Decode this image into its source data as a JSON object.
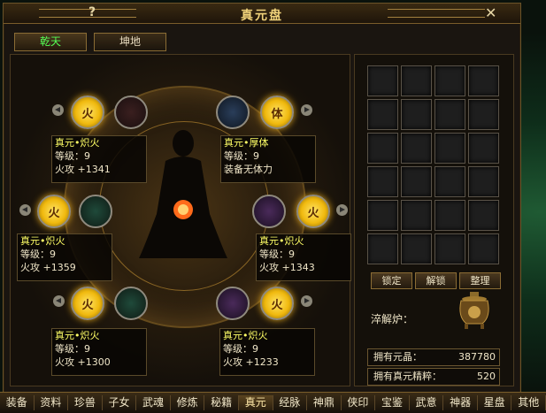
{
  "window": {
    "title": "真元盘",
    "help_label": "?",
    "close_label": "✕"
  },
  "tabs": [
    {
      "label": "乾天",
      "active": true
    },
    {
      "label": "坤地",
      "active": false
    }
  ],
  "slots": [
    {
      "fire_glyph": "火",
      "item_icon": "red-bag-icon",
      "name": "真元•炽火",
      "level": "等级：9",
      "attr": "火攻 +1341"
    },
    {
      "fire_glyph": "体",
      "item_icon": "scroll-icon",
      "name": "真元•厚体",
      "level": "等级：9",
      "attr": "装备无体力"
    },
    {
      "fire_glyph": "火",
      "item_icon": "green-red-bag-icon",
      "name": "真元•炽火",
      "level": "等级：9",
      "attr": "火攻 +1359"
    },
    {
      "fire_glyph": "火",
      "item_icon": "gold-seal-icon",
      "name": "真元•炽火",
      "level": "等级：9",
      "attr": "火攻 +1343"
    },
    {
      "fire_glyph": "火",
      "item_icon": "red-bag-icon",
      "name": "真元•炽火",
      "level": "等级：9",
      "attr": "火攻 +1300"
    },
    {
      "fire_glyph": "火",
      "item_icon": "gold-seal-icon",
      "name": "真元•炽火",
      "level": "等级：9",
      "attr": "火攻 +1233"
    }
  ],
  "inventory": {
    "rows": 6,
    "cols": 4
  },
  "buttons": {
    "lock": "锁定",
    "unlock": "解锁",
    "sort": "整理"
  },
  "furnace_label": "淬解炉：",
  "stats": [
    {
      "label": "拥有元晶：",
      "value": "387780"
    },
    {
      "label": "拥有真元精粹：",
      "value": "520"
    }
  ],
  "bottom_menu": [
    "装备",
    "资料",
    "珍兽",
    "子女",
    "武魂",
    "修炼",
    "秘籍",
    "真元",
    "经脉",
    "神鼎",
    "侠印",
    "宝鉴",
    "武意",
    "神器",
    "星盘",
    "其他"
  ],
  "bottom_active": "真元",
  "colors": {
    "accent_gold": "#f0d27a",
    "active_tab": "#55ff55",
    "item_name": "#ffff66"
  }
}
